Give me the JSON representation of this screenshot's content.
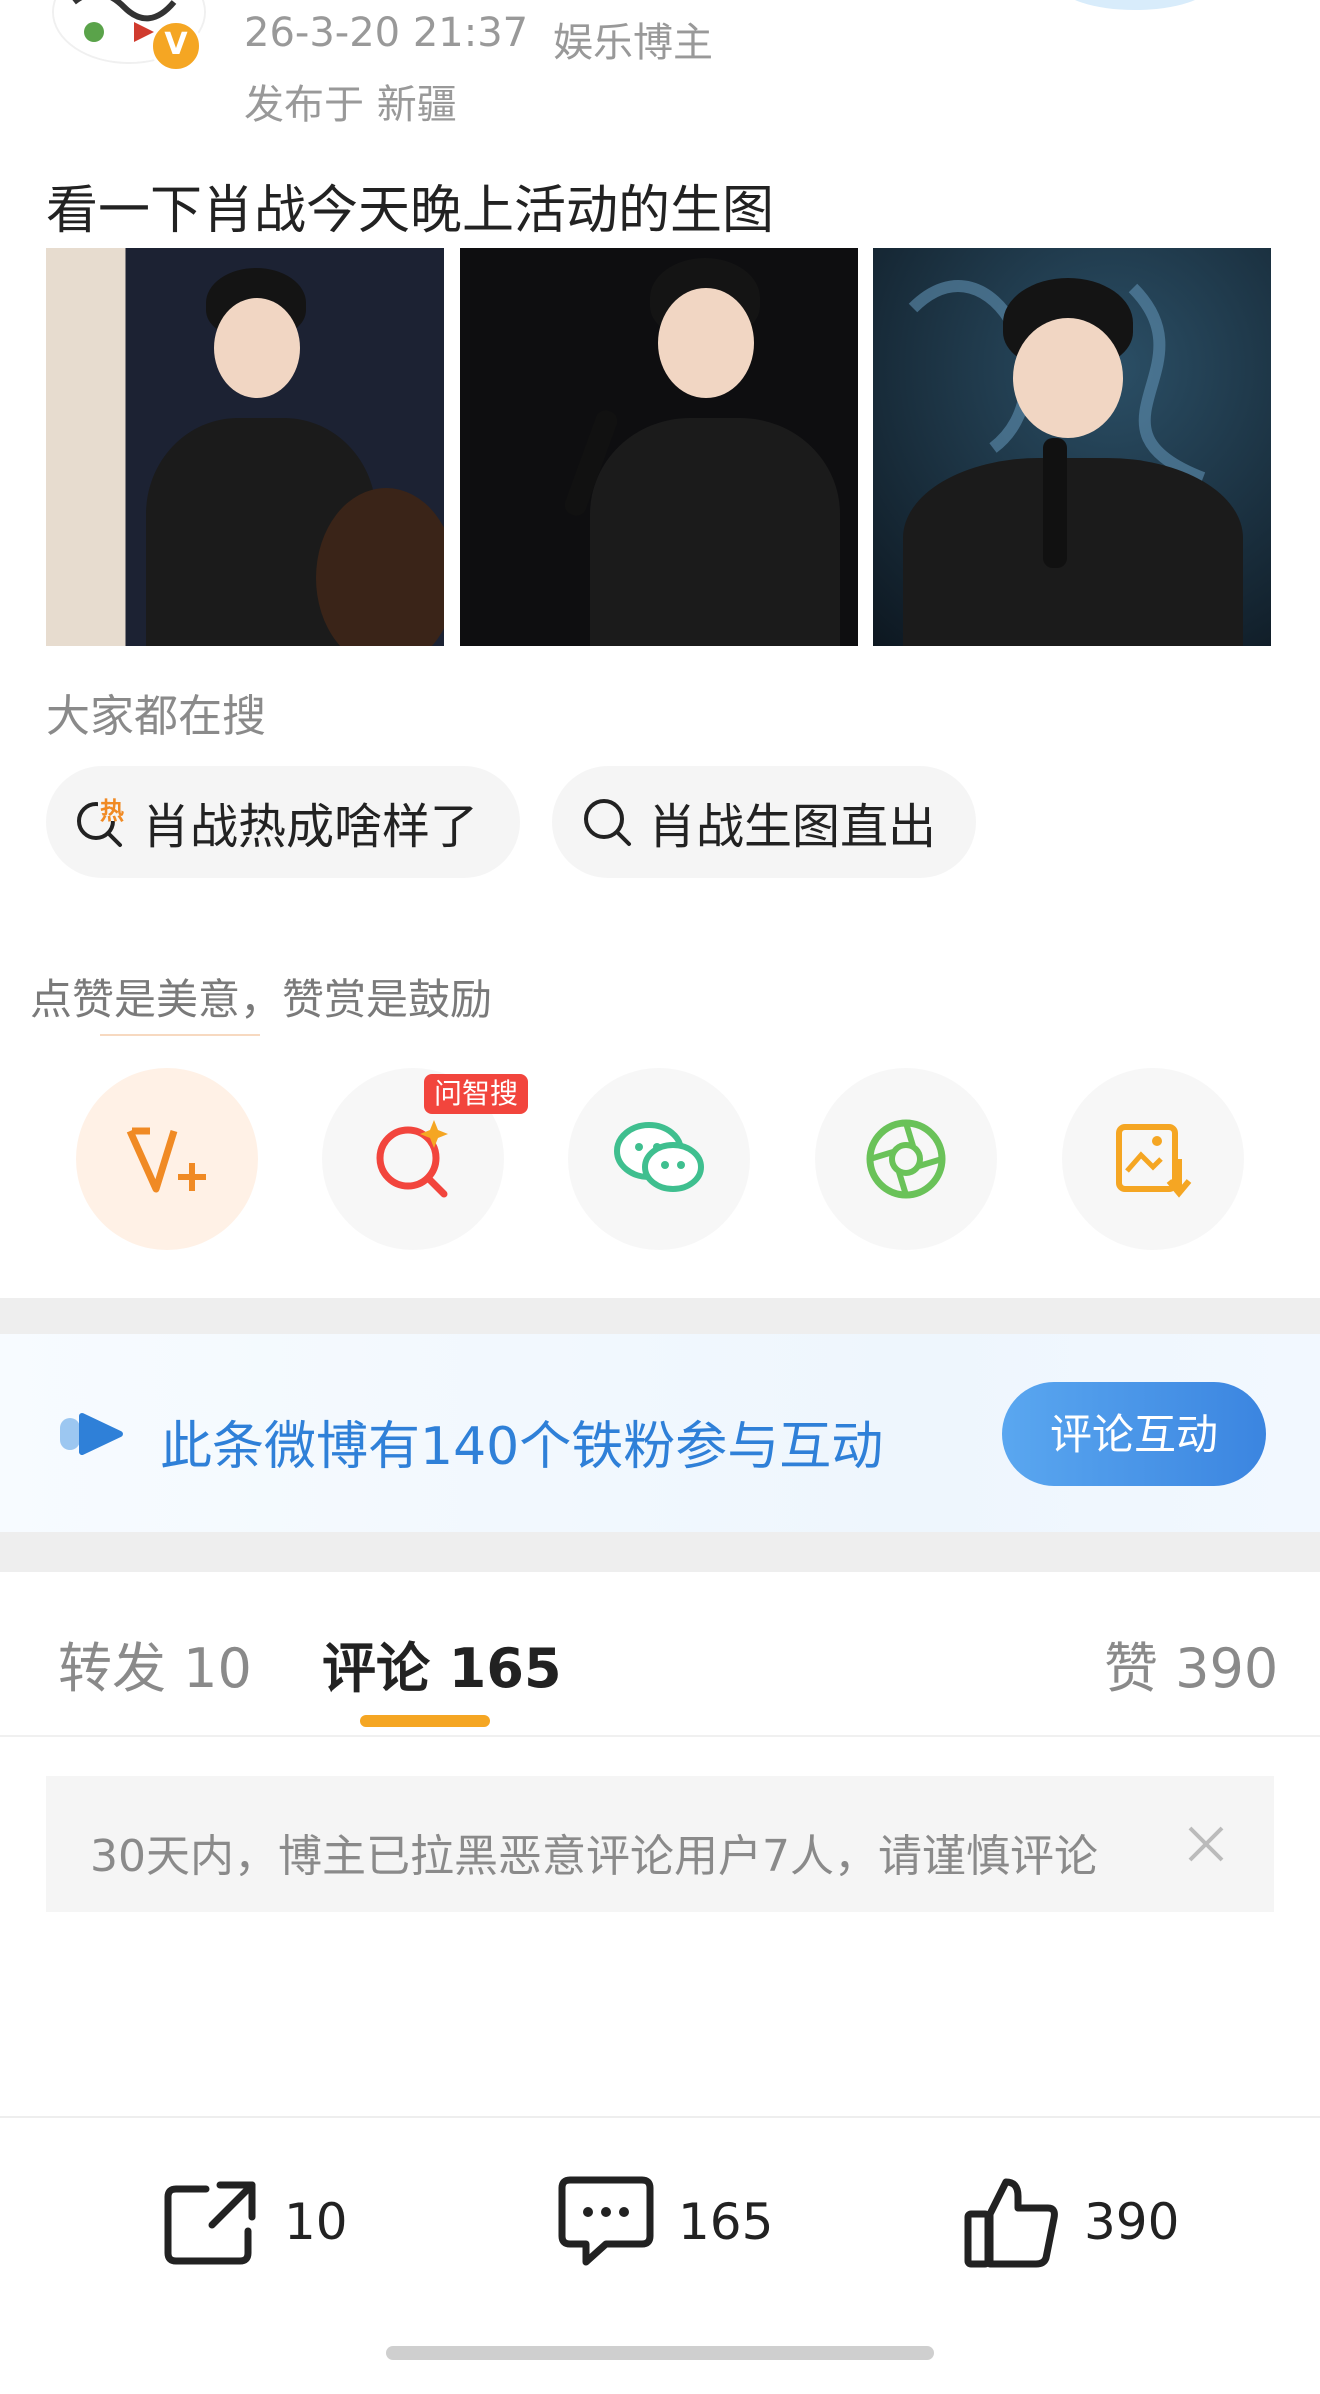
{
  "post": {
    "date": "26-3-20 21:37",
    "author_tag": "娱乐博主",
    "location": "发布于 新疆",
    "title": "看一下肖战今天晚上活动的生图"
  },
  "search": {
    "heading": "大家都在搜",
    "chips": [
      {
        "icon": "hot-search-icon",
        "label": "肖战热成啥样了"
      },
      {
        "icon": "search-icon",
        "label": "肖战生图直出"
      }
    ],
    "hot_glyph": "热"
  },
  "reward": {
    "text": "点赞是美意，赞赏是鼓励"
  },
  "actions": [
    {
      "icon": "v-plus-icon",
      "color": "#f08a24"
    },
    {
      "icon": "ai-search-icon",
      "color": "#f2453d",
      "badge": "问智搜"
    },
    {
      "icon": "wechat-icon",
      "color": "#3fbf8f"
    },
    {
      "icon": "moments-icon",
      "color": "#6ac259"
    },
    {
      "icon": "save-image-icon",
      "color": "#f5a623"
    }
  ],
  "fans_banner": {
    "text": "此条微博有140个铁粉参与互动",
    "button": "评论互动"
  },
  "tabs": {
    "repost": "转发 10",
    "comment": "评论 165",
    "likes": "赞 390"
  },
  "notice": {
    "text": "30天内，博主已拉黑恶意评论用户7人，请谨慎评论"
  },
  "teaser": "",
  "bottom_bar": {
    "repost_count": "10",
    "comment_count": "165",
    "like_count": "390"
  },
  "colors": {
    "accent_orange": "#f5a623",
    "link_blue": "#2f80d8",
    "badge_red": "#f2453d"
  }
}
